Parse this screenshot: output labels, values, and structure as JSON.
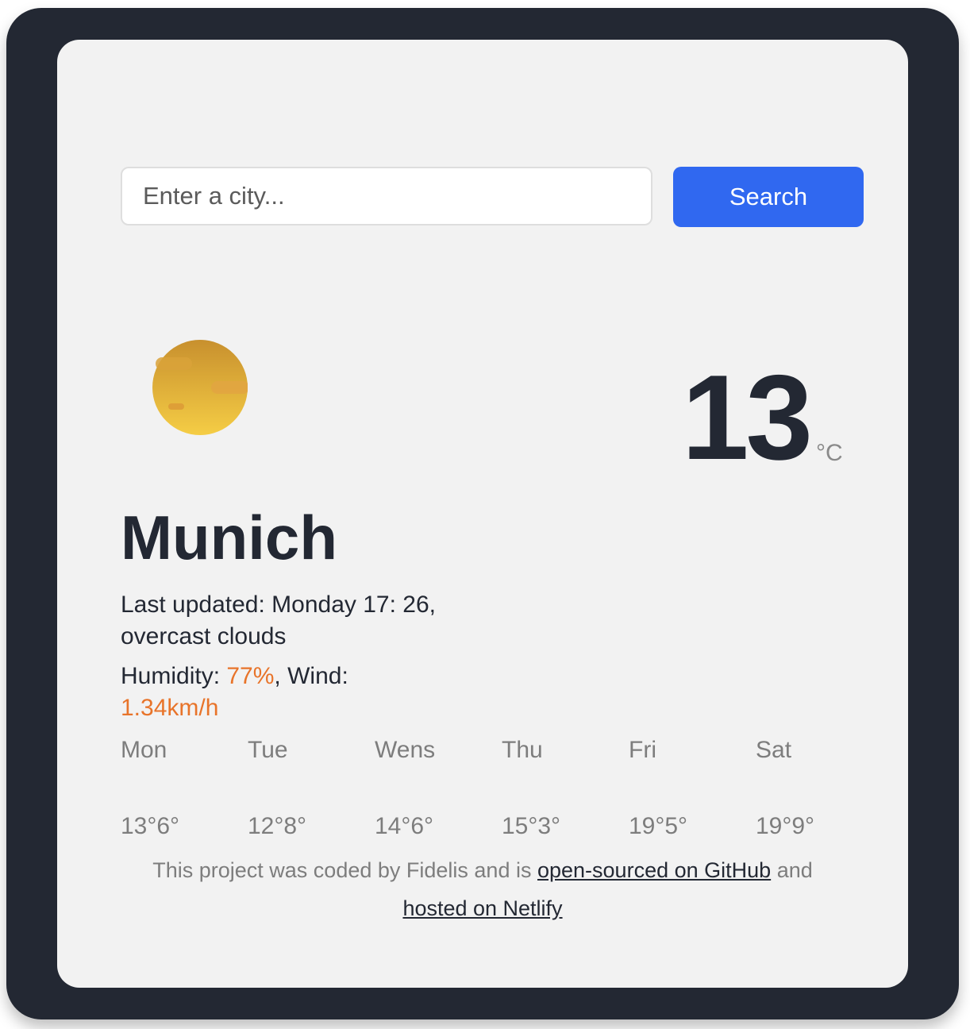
{
  "search": {
    "placeholder": "Enter a city...",
    "value": "",
    "button_label": "Search"
  },
  "current": {
    "icon": "weather-icon (sun behind haze/clouds)",
    "temperature": "13",
    "unit": "°C",
    "city": "Munich",
    "last_updated_label": "Last updated:",
    "last_updated_value": "Monday 17: 26,",
    "description": "overcast clouds",
    "humidity_label": "Humidity:",
    "humidity_value": "77%",
    "separator": ",",
    "wind_label": "Wind:",
    "wind_value": "1.34km/h"
  },
  "forecast": [
    {
      "day": "Mon",
      "temps": "13°6°"
    },
    {
      "day": "Tue",
      "temps": "12°8°"
    },
    {
      "day": "Wens",
      "temps": "14°6°"
    },
    {
      "day": "Thu",
      "temps": "15°3°"
    },
    {
      "day": "Fri",
      "temps": "19°5°"
    },
    {
      "day": "Sat",
      "temps": "19°9°"
    }
  ],
  "footer": {
    "text_before": "This project was coded by Fidelis and is",
    "github_link": "open-sourced on GitHub",
    "text_middle": "and",
    "netlify_link": "hosted on Netlify"
  },
  "colors": {
    "frame": "#232833",
    "card": "#f2f2f2",
    "accent": "#e8742a",
    "button": "#3068f0"
  }
}
